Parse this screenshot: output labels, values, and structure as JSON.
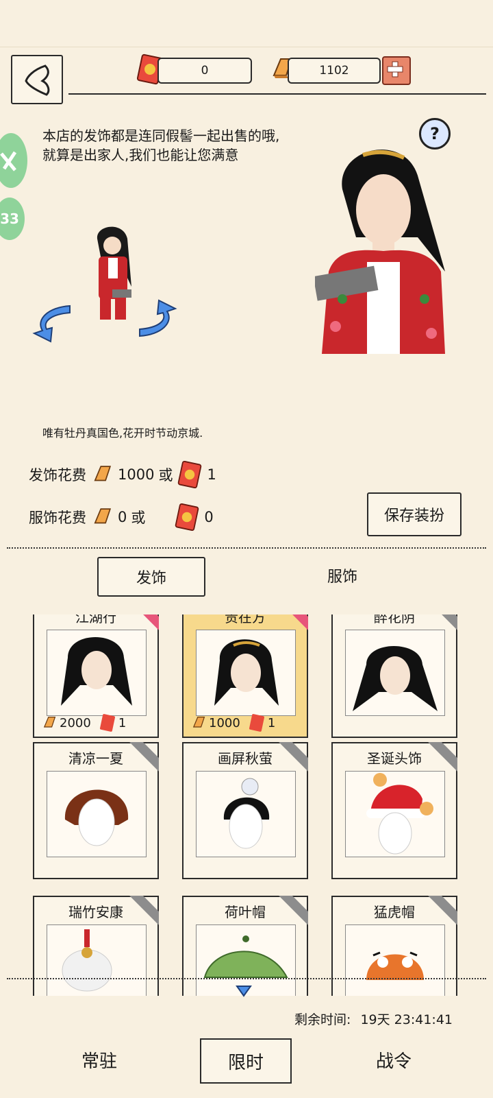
{
  "topbar": {
    "ticket_count": "0",
    "gold_count": "1102"
  },
  "dialogue": "本店的发饰都是连同假髻一起出售的哦,就算是出家人,我们也能让您满意",
  "side_badge": "33",
  "item_description": "唯有牡丹真国色,花开时节动京城.",
  "costs": {
    "hair_label": "发饰花费",
    "hair_gold": "1000",
    "hair_or": "或",
    "hair_ticket": "1",
    "clothes_label": "服饰花费",
    "clothes_gold": "0",
    "clothes_or": "或",
    "clothes_ticket": "0"
  },
  "save_label": "保存装扮",
  "tabs": {
    "hair": "发饰",
    "clothes": "服饰"
  },
  "items": [
    {
      "name": "江湖行",
      "price_gold": "2000",
      "price_ticket": "1",
      "badge": "hot"
    },
    {
      "name": "贵在方",
      "price_gold": "1000",
      "price_ticket": "1",
      "badge": "hot"
    },
    {
      "name": "醉花阴",
      "badge": "sold"
    },
    {
      "name": "清凉一夏",
      "badge": "sold"
    },
    {
      "name": "画屏秋萤",
      "badge": "sold"
    },
    {
      "name": "圣诞头饰",
      "badge": "sold"
    },
    {
      "name": "瑞竹安康",
      "badge": "sold"
    },
    {
      "name": "荷叶帽",
      "badge": "sold"
    },
    {
      "name": "猛虎帽",
      "badge": "sold"
    }
  ],
  "timer": {
    "label": "剩余时间:",
    "value": "19天 23:41:41"
  },
  "bottom_tabs": {
    "permanent": "常驻",
    "limited": "限时",
    "pass": "战令"
  },
  "colors": {
    "background": "#f8f0e0",
    "selected_card": "#f7d98c",
    "add_button": "#e8866a"
  }
}
